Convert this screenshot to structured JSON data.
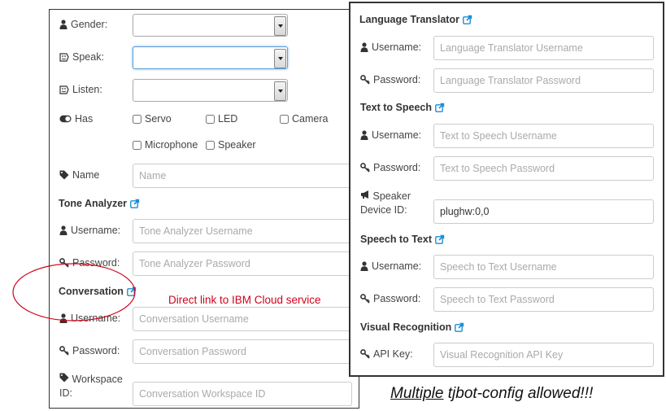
{
  "left": {
    "gender": {
      "label": "Gender:"
    },
    "speak": {
      "label": "Speak:"
    },
    "listen": {
      "label": "Listen:"
    },
    "has": {
      "label": "Has",
      "options": [
        "Servo",
        "LED",
        "Camera",
        "Microphone",
        "Speaker"
      ]
    },
    "name": {
      "label": "Name",
      "placeholder": "Name"
    },
    "tone": {
      "title": "Tone Analyzer",
      "username_label": "Username:",
      "username_placeholder": "Tone Analyzer Username",
      "password_label": "Password:",
      "password_placeholder": "Tone Analyzer Password"
    },
    "conversation": {
      "title": "Conversation",
      "username_label": "Username:",
      "username_placeholder": "Conversation Username",
      "password_label": "Password:",
      "password_placeholder": "Conversation Password",
      "workspace_label_1": "Workspace",
      "workspace_label_2": "ID:",
      "workspace_placeholder": "Conversation Workspace ID"
    }
  },
  "right": {
    "translator": {
      "title": "Language Translator",
      "username_label": "Username:",
      "username_placeholder": "Language Translator Username",
      "password_label": "Password:",
      "password_placeholder": "Language Translator Password"
    },
    "tts": {
      "title": "Text to Speech",
      "username_label": "Username:",
      "username_placeholder": "Text to Speech Username",
      "password_label": "Password:",
      "password_placeholder": "Text to Speech Password",
      "speaker_label_1": "Speaker",
      "speaker_label_2": "Device ID:",
      "speaker_value": "plughw:0,0"
    },
    "stt": {
      "title": "Speech to Text",
      "username_label": "Username:",
      "username_placeholder": "Speech to Text Username",
      "password_label": "Password:",
      "password_placeholder": "Speech to Text Password"
    },
    "visual": {
      "title": "Visual Recognition",
      "apikey_label": "API Key:",
      "apikey_placeholder": "Visual Recognition API Key"
    }
  },
  "annotation": "Direct link to IBM Cloud service",
  "footer": {
    "emph": "Multiple",
    "rest": " tjbot-config allowed!!!"
  },
  "colors": {
    "annotation": "#d0021b",
    "link_icon": "#1a8fd6",
    "focus_border": "#5b9dd9"
  }
}
